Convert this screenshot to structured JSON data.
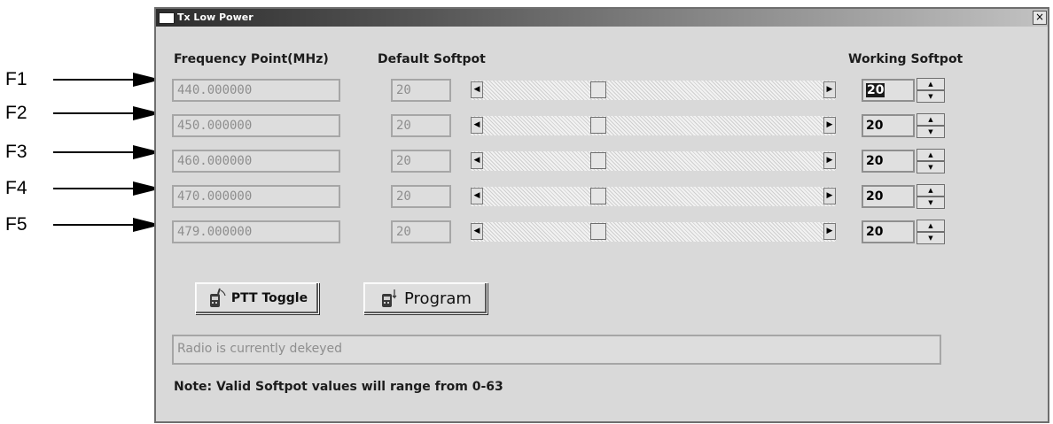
{
  "window": {
    "title": "Tx Low Power",
    "close_glyph": "×"
  },
  "headers": {
    "frequency": "Frequency Point(MHz)",
    "default": "Default Softpot",
    "working": "Working Softpot"
  },
  "callouts": [
    "F1",
    "F2",
    "F3",
    "F4",
    "F5"
  ],
  "rows": [
    {
      "frequency": "440.000000",
      "default": "20",
      "working": "20",
      "slider_fraction": 0.33,
      "selected": true
    },
    {
      "frequency": "450.000000",
      "default": "20",
      "working": "20",
      "slider_fraction": 0.33,
      "selected": false
    },
    {
      "frequency": "460.000000",
      "default": "20",
      "working": "20",
      "slider_fraction": 0.33,
      "selected": false
    },
    {
      "frequency": "470.000000",
      "default": "20",
      "working": "20",
      "slider_fraction": 0.33,
      "selected": false
    },
    {
      "frequency": "479.000000",
      "default": "20",
      "working": "20",
      "slider_fraction": 0.33,
      "selected": false
    }
  ],
  "buttons": {
    "ptt_toggle": "PTT Toggle",
    "program": "Program"
  },
  "status": "Radio is currently dekeyed",
  "note": "Note: Valid Softpot values will range from 0-63",
  "icons": {
    "scroll_left": "◀",
    "scroll_right": "▶",
    "spin_up": "▲",
    "spin_down": "▼"
  }
}
